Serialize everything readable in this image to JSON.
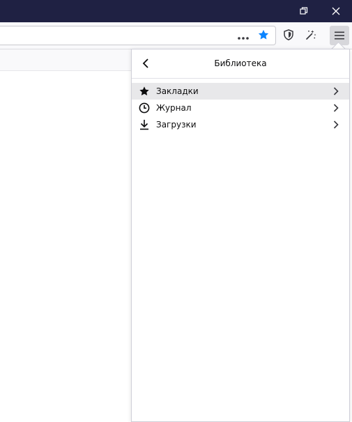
{
  "titlebar": {
    "color": "#1f2143",
    "buttons": [
      "restore-icon",
      "close-icon"
    ]
  },
  "toolbar": {
    "icons": [
      "page-actions-icon",
      "bookmark-star-icon",
      "tracking-protection-shield-icon",
      "customize-magic-wand-icon",
      "hamburger-menu-icon"
    ],
    "star_color": "#0a84ff"
  },
  "panel": {
    "title": "Библиотека",
    "back_icon": "chevron-left-icon",
    "items": [
      {
        "label": "Закладки",
        "icon": "star-icon",
        "active": true
      },
      {
        "label": "Журнал",
        "icon": "clock-icon",
        "active": false
      },
      {
        "label": "Загрузки",
        "icon": "download-icon",
        "active": false
      }
    ]
  }
}
